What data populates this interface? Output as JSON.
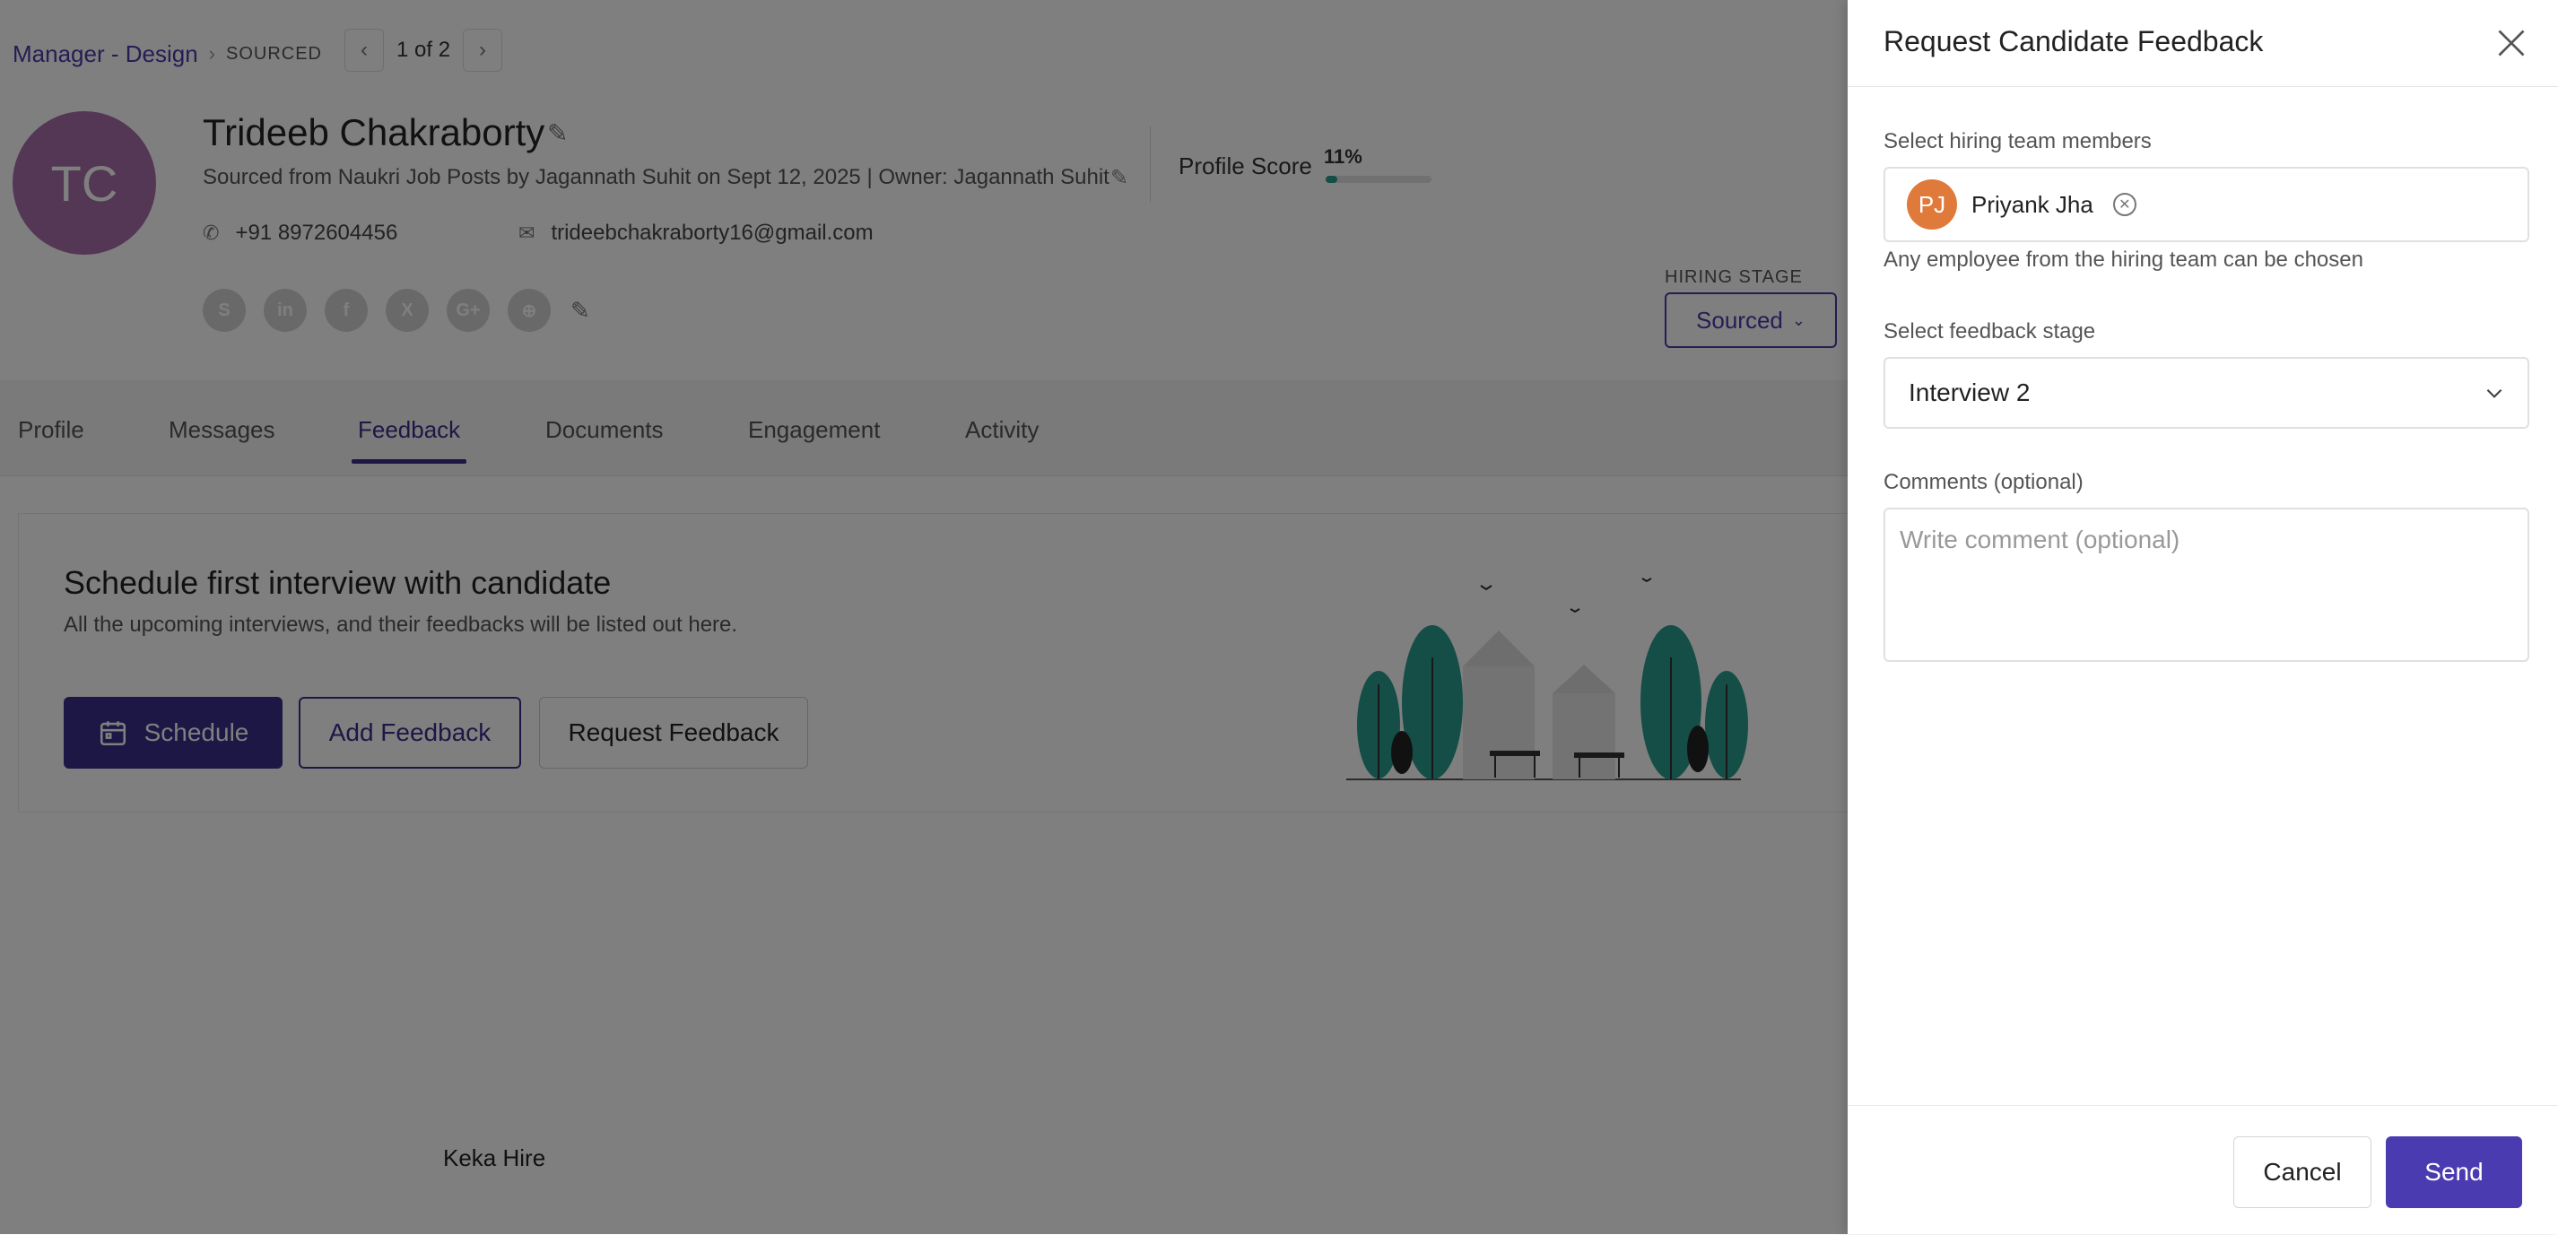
{
  "breadcrumb": {
    "parent": "Manager - Design",
    "separator": "›",
    "stage": "SOURCED"
  },
  "pager": {
    "text": "1 of 2",
    "prev": "‹",
    "next": "›"
  },
  "candidate": {
    "initials": "TC",
    "name": "Trideeb Chakraborty",
    "sourced_line": "Sourced from Naukri Job Posts by Jagannath Suhit on Sept 12, 2025   | Owner: Jagannath Suhit",
    "phone": "+91 8972604456",
    "email": "trideebchakraborty16@gmail.com",
    "socials": [
      "S",
      "in",
      "f",
      "X",
      "G+",
      "⊕"
    ]
  },
  "profile_score": {
    "label": "Profile Score",
    "value": "11%",
    "fraction": 0.11,
    "color": "#2a9d8f"
  },
  "hiring_stage": {
    "label": "HIRING STAGE",
    "value": "Sourced"
  },
  "tabs": [
    {
      "label": "Profile"
    },
    {
      "label": "Messages"
    },
    {
      "label": "Feedback"
    },
    {
      "label": "Documents"
    },
    {
      "label": "Engagement"
    },
    {
      "label": "Activity"
    }
  ],
  "feedback_card": {
    "title": "Schedule first interview with candidate",
    "subtitle": "All the upcoming interviews, and their feedbacks will be listed out here.",
    "schedule_label": "Schedule",
    "add_feedback_label": "Add Feedback",
    "request_feedback_label": "Request Feedback"
  },
  "footer": {
    "brand": "Keka Hire"
  },
  "drawer": {
    "title": "Request Candidate Feedback",
    "members_label": "Select hiring team members",
    "member": {
      "initials": "PJ",
      "name": "Priyank Jha"
    },
    "members_hint": "Any employee from the hiring team can be chosen",
    "stage_label": "Select feedback stage",
    "stage_value": "Interview 2",
    "comments_label": "Comments (optional)",
    "comments_placeholder": "Write comment (optional)",
    "cancel_label": "Cancel",
    "send_label": "Send"
  },
  "colors": {
    "accent": "#3a2e8c",
    "send": "#4b3bb0",
    "avatar": "#a86cab",
    "member_avatar": "#e07a3a"
  }
}
